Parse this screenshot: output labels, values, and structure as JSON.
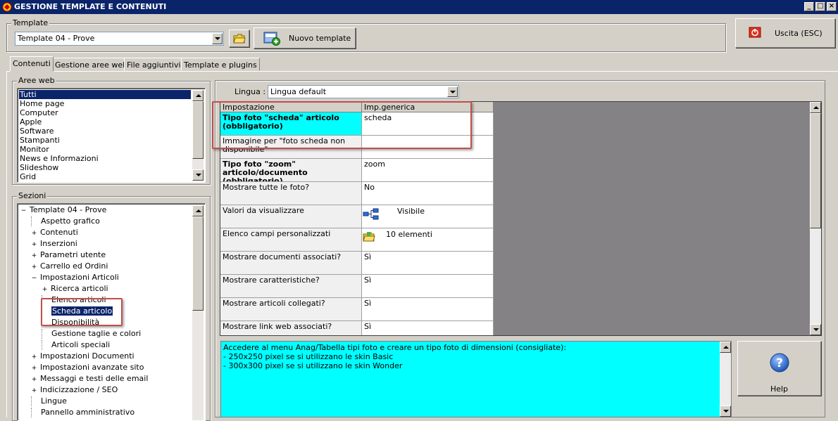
{
  "window": {
    "title": "GESTIONE TEMPLATE E CONTENUTI"
  },
  "template": {
    "label": "Template",
    "selected": "Template 04 - Prove",
    "new_button": "Nuovo template"
  },
  "exit_button": "Uscita (ESC)",
  "tabs": [
    {
      "label": "Contenuti",
      "active": true
    },
    {
      "label": "Gestione aree web"
    },
    {
      "label": "File aggiuntivi"
    },
    {
      "label": "Template e plugins"
    }
  ],
  "aree_web": {
    "label": "Aree web",
    "items": [
      "Tutti",
      "Home page",
      "Computer",
      "Apple",
      "Software",
      "Stampanti",
      "Monitor",
      "News e Informazioni",
      "Slideshow",
      "Grid"
    ],
    "selected": "Tutti"
  },
  "sezioni": {
    "label": "Sezioni",
    "items": [
      {
        "label": "Template 04 - Prove",
        "depth": 0,
        "exp": "−"
      },
      {
        "label": "Aspetto grafico",
        "depth": 1,
        "exp": ""
      },
      {
        "label": "Contenuti",
        "depth": 1,
        "exp": "+"
      },
      {
        "label": "Inserzioni",
        "depth": 1,
        "exp": "+"
      },
      {
        "label": "Parametri utente",
        "depth": 1,
        "exp": "+"
      },
      {
        "label": "Carrello ed Ordini",
        "depth": 1,
        "exp": "+"
      },
      {
        "label": "Impostazioni Articoli",
        "depth": 1,
        "exp": "−"
      },
      {
        "label": "Ricerca articoli",
        "depth": 2,
        "exp": "+"
      },
      {
        "label": "Elenco articoli",
        "depth": 2,
        "exp": ""
      },
      {
        "label": "Scheda articolo",
        "depth": 2,
        "exp": "",
        "selected": true
      },
      {
        "label": "Disponibilità",
        "depth": 2,
        "exp": ""
      },
      {
        "label": "Gestione taglie e colori",
        "depth": 2,
        "exp": ""
      },
      {
        "label": "Articoli speciali",
        "depth": 2,
        "exp": ""
      },
      {
        "label": "Impostazioni Documenti",
        "depth": 1,
        "exp": "+"
      },
      {
        "label": "Impostazioni avanzate sito",
        "depth": 1,
        "exp": "+"
      },
      {
        "label": "Messaggi e testi delle email",
        "depth": 1,
        "exp": "+"
      },
      {
        "label": "Indicizzazione / SEO",
        "depth": 1,
        "exp": "+"
      },
      {
        "label": "Lingue",
        "depth": 1,
        "exp": ""
      },
      {
        "label": "Pannello amministrativo",
        "depth": 1,
        "exp": ""
      }
    ]
  },
  "lingua": {
    "label": "Lingua :",
    "selected": "Lingua default"
  },
  "grid": {
    "headers": [
      "Impostazione",
      "Imp.generica"
    ],
    "rows": [
      {
        "label": "Tipo foto \"scheda\" articolo (obbligatorio)",
        "value": "scheda",
        "required": true,
        "current": true
      },
      {
        "label": "Immagine per \"foto scheda non disponibile\"",
        "value": ""
      },
      {
        "label": "Tipo foto \"zoom\" articolo/documento (obbligatorio)",
        "value": "zoom",
        "required": true
      },
      {
        "label": "Mostrare tutte le foto?",
        "value": "No"
      },
      {
        "label": "Valori da visualizzare",
        "value": "Visibile",
        "icon": "tree-structure-icon"
      },
      {
        "label": "Elenco campi personalizzati",
        "value": "10 elementi",
        "icon": "folder-icon"
      },
      {
        "label": "Mostrare documenti associati?",
        "value": "Sì"
      },
      {
        "label": "Mostrare caratteristiche?",
        "value": "Sì"
      },
      {
        "label": "Mostrare articoli collegati?",
        "value": "Sì"
      },
      {
        "label": "Mostrare link web associati?",
        "value": "Sì"
      }
    ]
  },
  "description": {
    "lines": [
      "Accedere al menu Anag/Tabella tipi foto e creare un tipo foto di dimensioni (consigliate):",
      "- 250x250 pixel se si utilizzano le skin Basic",
      "- 300x300 pixel se si utilizzano le skin Wonder"
    ]
  },
  "help_button": "Help",
  "colors": {
    "titlebar": "#0a246a",
    "selection": "#0a246a",
    "highlight_cyan": "#00ffff",
    "annotation": "#c0504d",
    "panel": "#d4d0c8"
  }
}
